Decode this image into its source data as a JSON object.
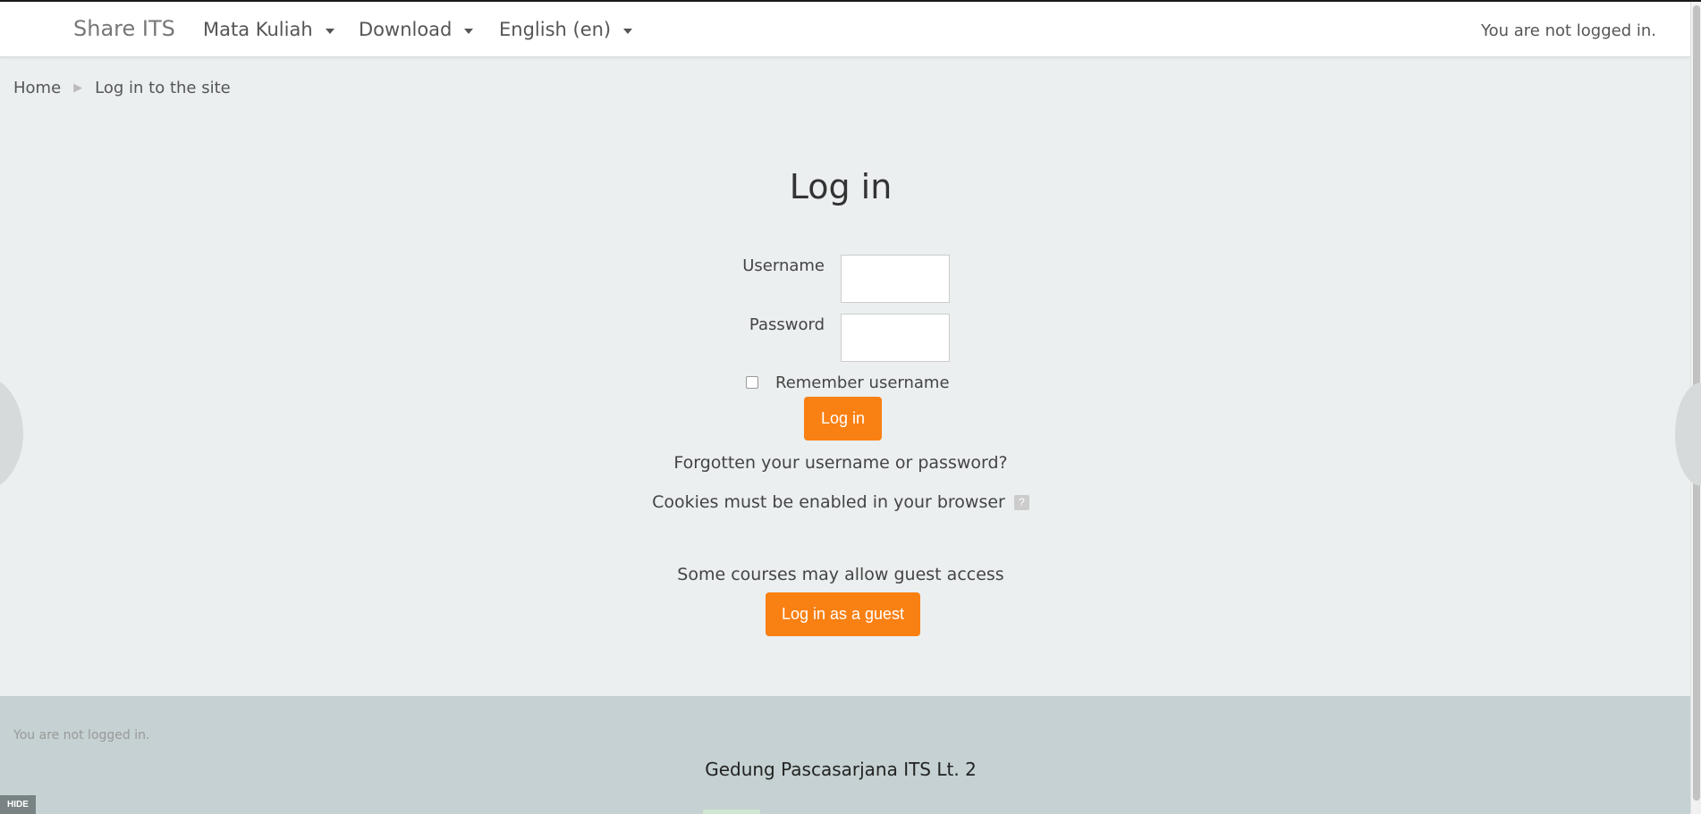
{
  "navbar": {
    "brand": "Share ITS",
    "menu": [
      {
        "label": "Mata Kuliah"
      },
      {
        "label": "Download"
      },
      {
        "label": "English (en)"
      }
    ],
    "login_status": "You are not logged in."
  },
  "breadcrumb": {
    "home": "Home",
    "current": "Log in to the site"
  },
  "login": {
    "title": "Log in",
    "username_label": "Username",
    "username_value": "",
    "password_label": "Password",
    "password_value": "",
    "remember_label": "Remember username",
    "remember_checked": false,
    "submit_label": "Log in",
    "forgot_link": "Forgotten your username or password?",
    "cookies_text": "Cookies must be enabled in your browser",
    "help_icon": "?",
    "guest_text": "Some courses may allow guest access",
    "guest_button": "Log in as a guest"
  },
  "footer": {
    "login_status": "You are not logged in.",
    "address": "Gedung Pascasarjana ITS Lt. 2"
  },
  "hide_badge": "HIDE",
  "colors": {
    "accent": "#f98012",
    "background": "#ebeff0",
    "footer": "#c5d1d2"
  },
  "icons": [
    "caret-down-icon",
    "breadcrumb-separator-icon",
    "help-icon"
  ]
}
